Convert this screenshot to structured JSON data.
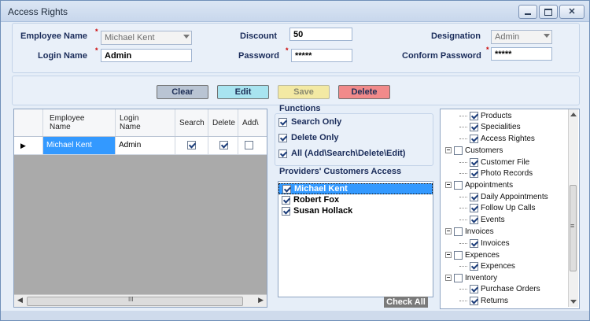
{
  "window": {
    "title": "Access Rights"
  },
  "form": {
    "employee_name_label": "Employee Name",
    "employee_name_value": "Michael Kent",
    "login_name_label": "Login Name",
    "login_name_value": "Admin",
    "discount_label": "Discount",
    "discount_value": "50",
    "password_label": "Password",
    "password_value": "*****",
    "designation_label": "Designation",
    "designation_value": "Admin",
    "confirm_password_label": "Conform Password",
    "confirm_password_value": "*****",
    "required_mark": "*"
  },
  "toolbar": {
    "clear_label": "Clear",
    "edit_label": "Edit",
    "save_label": "Save",
    "delete_label": "Delete"
  },
  "grid": {
    "headers": [
      "Employee Name",
      "Login Name",
      "Search",
      "Delete",
      "Add\\"
    ],
    "header_lines": [
      [
        "Employee",
        "Name"
      ],
      [
        "Login",
        "Name"
      ]
    ],
    "rows": [
      {
        "employee_name": "Michael Kent",
        "login_name": "Admin",
        "search": true,
        "delete": true
      }
    ],
    "hscroll_glyph": "III"
  },
  "functions": {
    "title": "Functions",
    "items": [
      {
        "label": "Search Only",
        "checked": true
      },
      {
        "label": "Delete Only",
        "checked": true
      },
      {
        "label": "All (Add\\Search\\Delete\\Edit)",
        "checked": true
      }
    ]
  },
  "providers": {
    "title": "Providers' Customers Access",
    "items": [
      {
        "label": "Michael Kent",
        "checked": true,
        "selected": true
      },
      {
        "label": "Robert Fox",
        "checked": true,
        "selected": false
      },
      {
        "label": "Susan Hollack",
        "checked": true,
        "selected": false
      }
    ],
    "check_all_label": "Check All"
  },
  "tree": {
    "nodes": [
      {
        "label": "Products",
        "level": 1,
        "checked": true
      },
      {
        "label": "Specialities",
        "level": 1,
        "checked": true
      },
      {
        "label": "Access Rightes",
        "level": 1,
        "checked": true
      },
      {
        "label": "Customers",
        "level": 0,
        "checked": false
      },
      {
        "label": "Customer File",
        "level": 1,
        "checked": true
      },
      {
        "label": "Photo Records",
        "level": 1,
        "checked": true
      },
      {
        "label": "Appointments",
        "level": 0,
        "checked": false
      },
      {
        "label": "Daily Appointments",
        "level": 1,
        "checked": true
      },
      {
        "label": "Follow Up Calls",
        "level": 1,
        "checked": true
      },
      {
        "label": "Events",
        "level": 1,
        "checked": true
      },
      {
        "label": "Invoices",
        "level": 0,
        "checked": false
      },
      {
        "label": "Invoices",
        "level": 1,
        "checked": true
      },
      {
        "label": "Expences",
        "level": 0,
        "checked": false
      },
      {
        "label": "Expences",
        "level": 1,
        "checked": true
      },
      {
        "label": "Inventory",
        "level": 0,
        "checked": false
      },
      {
        "label": "Purchase Orders",
        "level": 1,
        "checked": true
      },
      {
        "label": "Returns",
        "level": 1,
        "checked": true
      }
    ],
    "vscroll_glyph": "≡"
  },
  "colors": {
    "clear": "#b9c4d3",
    "edit": "#a8e4f0",
    "save": "#f3e9a3",
    "delete": "#f18a8a",
    "selection": "#3399ff"
  }
}
